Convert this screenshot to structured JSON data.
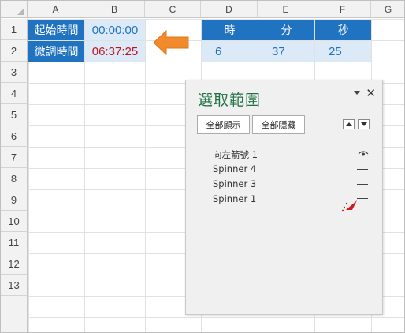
{
  "columns": [
    "A",
    "B",
    "C",
    "D",
    "E",
    "F",
    "G"
  ],
  "rows": [
    "1",
    "2",
    "3",
    "4",
    "5",
    "6",
    "7",
    "8",
    "9",
    "10",
    "11",
    "12",
    "13"
  ],
  "cells": {
    "a1": "起始時間",
    "b1": "00:00:00",
    "a2": "微調時間",
    "b2": "06:37:25",
    "d1": "時",
    "e1": "分",
    "f1": "秒",
    "d2": "6",
    "e2": "37",
    "f2": "25"
  },
  "colors": {
    "header_blue": "#1f73c0",
    "light_blue": "#dce9f6",
    "time_red": "#c0141c",
    "arrow_orange": "#f08a2c",
    "pane_title_green": "#217346"
  },
  "selection_pane": {
    "title": "選取範圍",
    "show_all_label": "全部顯示",
    "hide_all_label": "全部隱藏",
    "items": [
      {
        "name": "向左箭號 1",
        "visibility": "eye-icon"
      },
      {
        "name": "Spinner 4",
        "visibility": "dash"
      },
      {
        "name": "Spinner 3",
        "visibility": "dash"
      },
      {
        "name": "Spinner 1",
        "visibility": "dash"
      }
    ]
  }
}
